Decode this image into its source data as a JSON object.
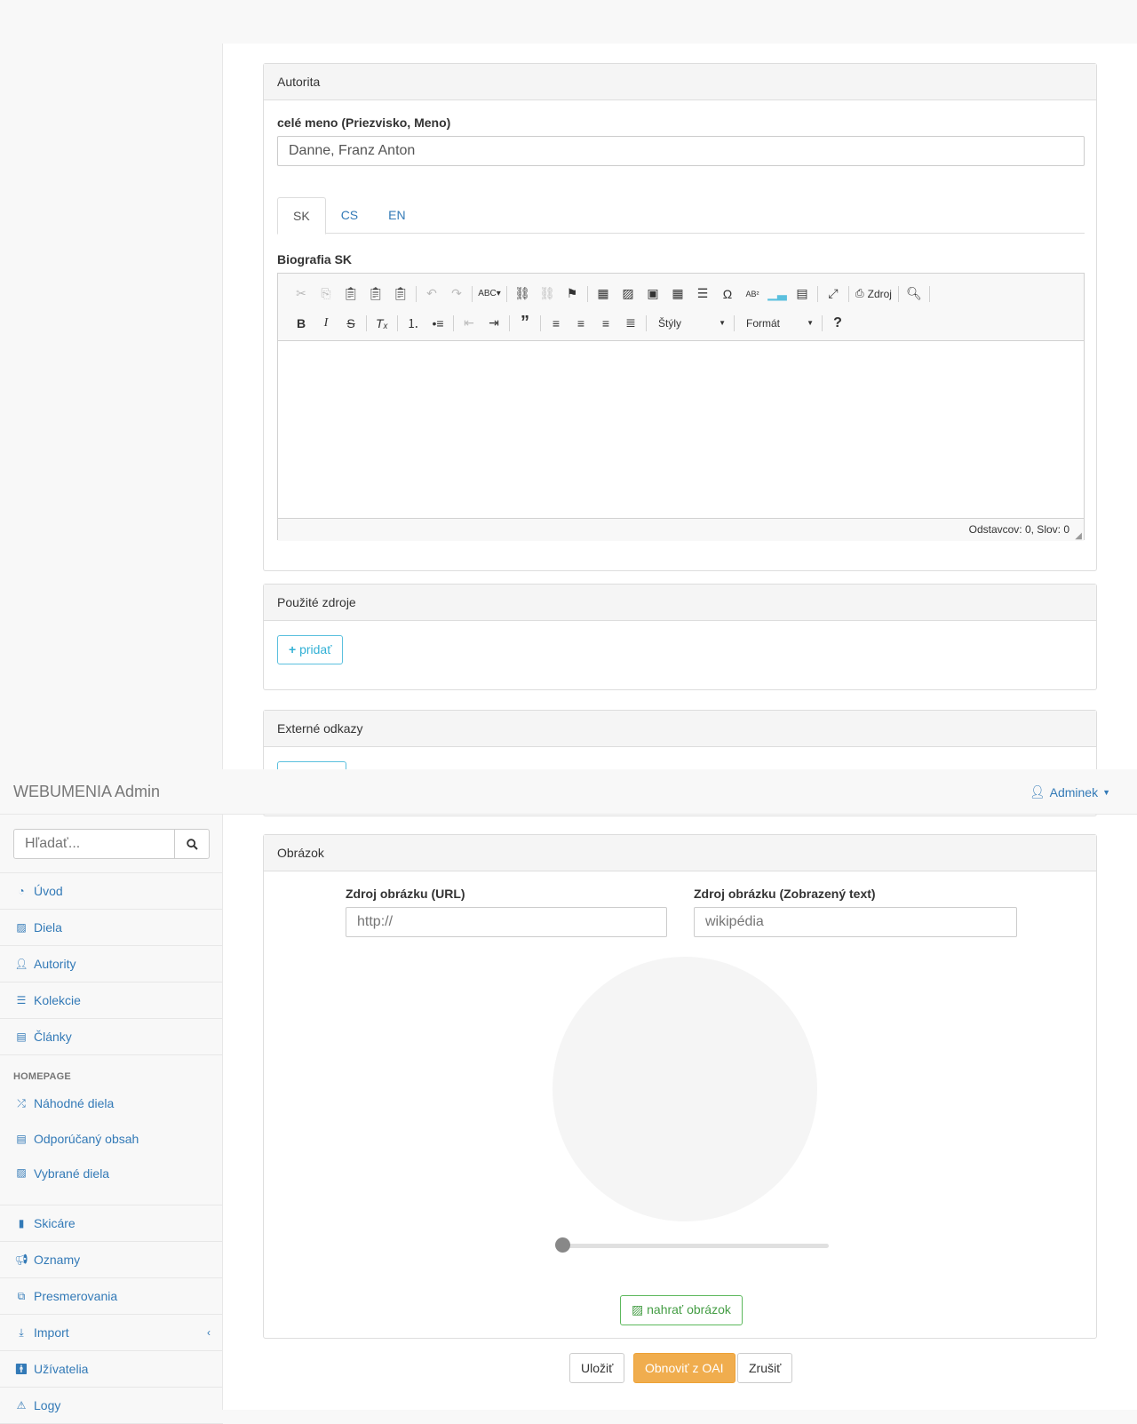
{
  "navbar": {
    "brand": "WEBUMENIA Admin",
    "user": "Adminek"
  },
  "sidebar": {
    "search_placeholder": "Hľadať...",
    "items": [
      {
        "label": "Úvod",
        "icon": "dashboard-icon"
      },
      {
        "label": "Diela",
        "icon": "picture-icon"
      },
      {
        "label": "Autority",
        "icon": "user-icon"
      },
      {
        "label": "Kolekcie",
        "icon": "list-icon"
      },
      {
        "label": "Články",
        "icon": "newspaper-icon"
      }
    ],
    "homepage_header": "HOMEPAGE",
    "homepage_items": [
      {
        "label": "Náhodné diela",
        "icon": "random-icon"
      },
      {
        "label": "Odporúčaný obsah",
        "icon": "newspaper-icon"
      },
      {
        "label": "Vybrané diela",
        "icon": "picture-icon"
      }
    ],
    "bottom_items": [
      {
        "label": "Skicáre",
        "icon": "book-icon"
      },
      {
        "label": "Oznamy",
        "icon": "bullhorn-icon"
      },
      {
        "label": "Presmerovania",
        "icon": "external-link-icon"
      },
      {
        "label": "Import",
        "icon": "download-icon"
      },
      {
        "label": "Užívatelia",
        "icon": "male-icon"
      },
      {
        "label": "Logy",
        "icon": "warning-icon"
      }
    ]
  },
  "autorita": {
    "heading": "Autorita",
    "name_label": "celé meno (Priezvisko, Meno)",
    "name_value": "Danne, Franz Anton",
    "tabs": [
      "SK",
      "CS",
      "EN"
    ],
    "bio_label": "Biografia SK",
    "toolbar": {
      "source_label": "Zdroj",
      "styles_label": "Štýly",
      "format_label": "Formát",
      "help": "?"
    },
    "status": "Odstavcov: 0, Slov: 0"
  },
  "sources": {
    "heading": "Použité zdroje",
    "add_label": "pridať"
  },
  "links": {
    "heading": "Externé odkazy"
  },
  "image": {
    "heading": "Obrázok",
    "url_label": "Zdroj obrázku (URL)",
    "url_placeholder": "http://",
    "text_label": "Zdroj obrázku (Zobrazený text)",
    "text_placeholder": "wikipédia",
    "slider_value": 0,
    "upload_label": "nahrať obrázok"
  },
  "actions": {
    "save": "Uložiť",
    "refresh": "Obnoviť z OAI",
    "cancel": "Zrušiť"
  }
}
